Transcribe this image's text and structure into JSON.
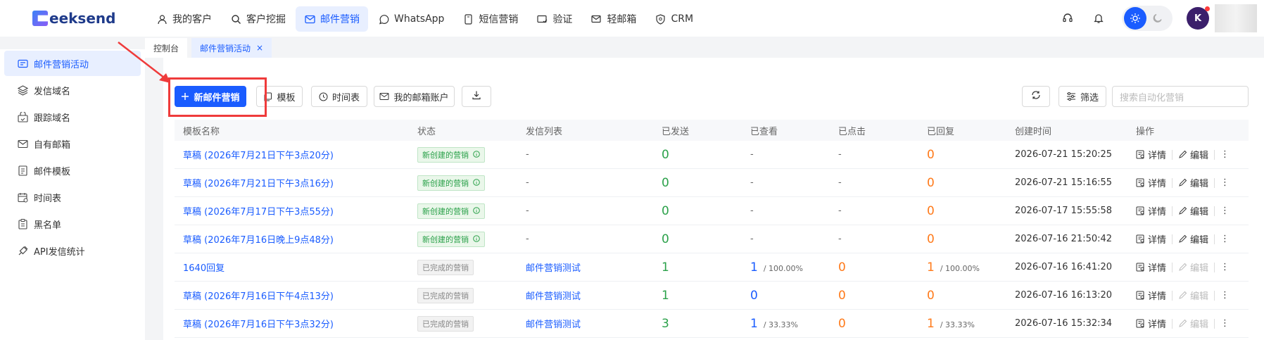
{
  "brand": {
    "logo_text": "eeksend",
    "logo_letter": "G"
  },
  "nav": [
    {
      "label": "我的客户",
      "icon": "user-icon"
    },
    {
      "label": "客户挖掘",
      "icon": "search-icon"
    },
    {
      "label": "邮件营销",
      "icon": "mail-icon",
      "active": true
    },
    {
      "label": "WhatsApp",
      "icon": "whatsapp-icon"
    },
    {
      "label": "短信营销",
      "icon": "sms-icon"
    },
    {
      "label": "验证",
      "icon": "verify-icon"
    },
    {
      "label": "轻邮箱",
      "icon": "light-mail-icon"
    },
    {
      "label": "CRM",
      "icon": "crm-icon"
    }
  ],
  "header_right": {
    "avatar_letter": "K"
  },
  "tabs": [
    {
      "label": "控制台"
    },
    {
      "label": "邮件营销活动",
      "active": true,
      "close": "×"
    }
  ],
  "sidebar": [
    {
      "label": "邮件营销活动",
      "active": true,
      "icon": "campaign-icon"
    },
    {
      "label": "发信域名",
      "icon": "domain-icon"
    },
    {
      "label": "跟踪域名",
      "icon": "track-domain-icon"
    },
    {
      "label": "自有邮箱",
      "icon": "own-mailbox-icon"
    },
    {
      "label": "邮件模板",
      "icon": "template-icon"
    },
    {
      "label": "时间表",
      "icon": "calendar-icon"
    },
    {
      "label": "黑名单",
      "icon": "blacklist-icon"
    },
    {
      "label": "API发信统计",
      "icon": "api-icon"
    }
  ],
  "toolbar": {
    "new_label": "新邮件营销",
    "template_label": "模板",
    "schedule_label": "时间表",
    "accounts_label": "我的邮箱账户",
    "filter_label": "筛选",
    "search_placeholder": "搜索自动化营销"
  },
  "table": {
    "columns": [
      "模板名称",
      "状态",
      "发信列表",
      "已发送",
      "已查看",
      "已点击",
      "已回复",
      "创建时间",
      "操作"
    ],
    "ops": {
      "detail": "详情",
      "edit": "编辑",
      "more": "⋮"
    },
    "rows": [
      {
        "name": "草稿 (2026年7月21日下午3点20分)",
        "status": "新创建的营销",
        "status_type": "new",
        "list": "-",
        "sent": "0",
        "viewed": "-",
        "viewed_pct": "",
        "clicked": "-",
        "replied": "0",
        "replied_pct": "",
        "created": "2026-07-21 15:20:25",
        "editable": true
      },
      {
        "name": "草稿 (2026年7月21日下午3点16分)",
        "status": "新创建的营销",
        "status_type": "new",
        "list": "-",
        "sent": "0",
        "viewed": "-",
        "viewed_pct": "",
        "clicked": "-",
        "replied": "0",
        "replied_pct": "",
        "created": "2026-07-21 15:16:55",
        "editable": true
      },
      {
        "name": "草稿 (2026年7月17日下午3点55分)",
        "status": "新创建的营销",
        "status_type": "new",
        "list": "-",
        "sent": "0",
        "viewed": "-",
        "viewed_pct": "",
        "clicked": "-",
        "replied": "0",
        "replied_pct": "",
        "created": "2026-07-17 15:55:58",
        "editable": true
      },
      {
        "name": "草稿 (2026年7月16日晚上9点48分)",
        "status": "新创建的营销",
        "status_type": "new",
        "list": "-",
        "sent": "0",
        "viewed": "-",
        "viewed_pct": "",
        "clicked": "-",
        "replied": "0",
        "replied_pct": "",
        "created": "2026-07-16 21:50:42",
        "editable": true
      },
      {
        "name": "1640回复",
        "status": "已完成的营销",
        "status_type": "done",
        "list": "邮件营销测试",
        "sent": "1",
        "viewed": "1",
        "viewed_pct": "/ 100.00%",
        "clicked": "0",
        "replied": "1",
        "replied_pct": "/ 100.00%",
        "created": "2026-07-16 16:41:20",
        "editable": false
      },
      {
        "name": "草稿 (2026年7月16日下午4点13分)",
        "status": "已完成的营销",
        "status_type": "done",
        "list": "邮件营销测试",
        "sent": "1",
        "viewed": "0",
        "viewed_pct": "",
        "clicked": "0",
        "replied": "0",
        "replied_pct": "",
        "created": "2026-07-16 16:13:20",
        "editable": false
      },
      {
        "name": "草稿 (2026年7月16日下午3点32分)",
        "status": "已完成的营销",
        "status_type": "done",
        "list": "邮件营销测试",
        "sent": "3",
        "viewed": "1",
        "viewed_pct": "/ 33.33%",
        "clicked": "0",
        "replied": "1",
        "replied_pct": "/ 33.33%",
        "created": "2026-07-16 15:32:34",
        "editable": false
      }
    ]
  },
  "colors": {
    "accent": "#1a5cff",
    "green": "#2ba14a",
    "orange": "#ff7a1a",
    "annotation_red": "#ef3b3b"
  }
}
